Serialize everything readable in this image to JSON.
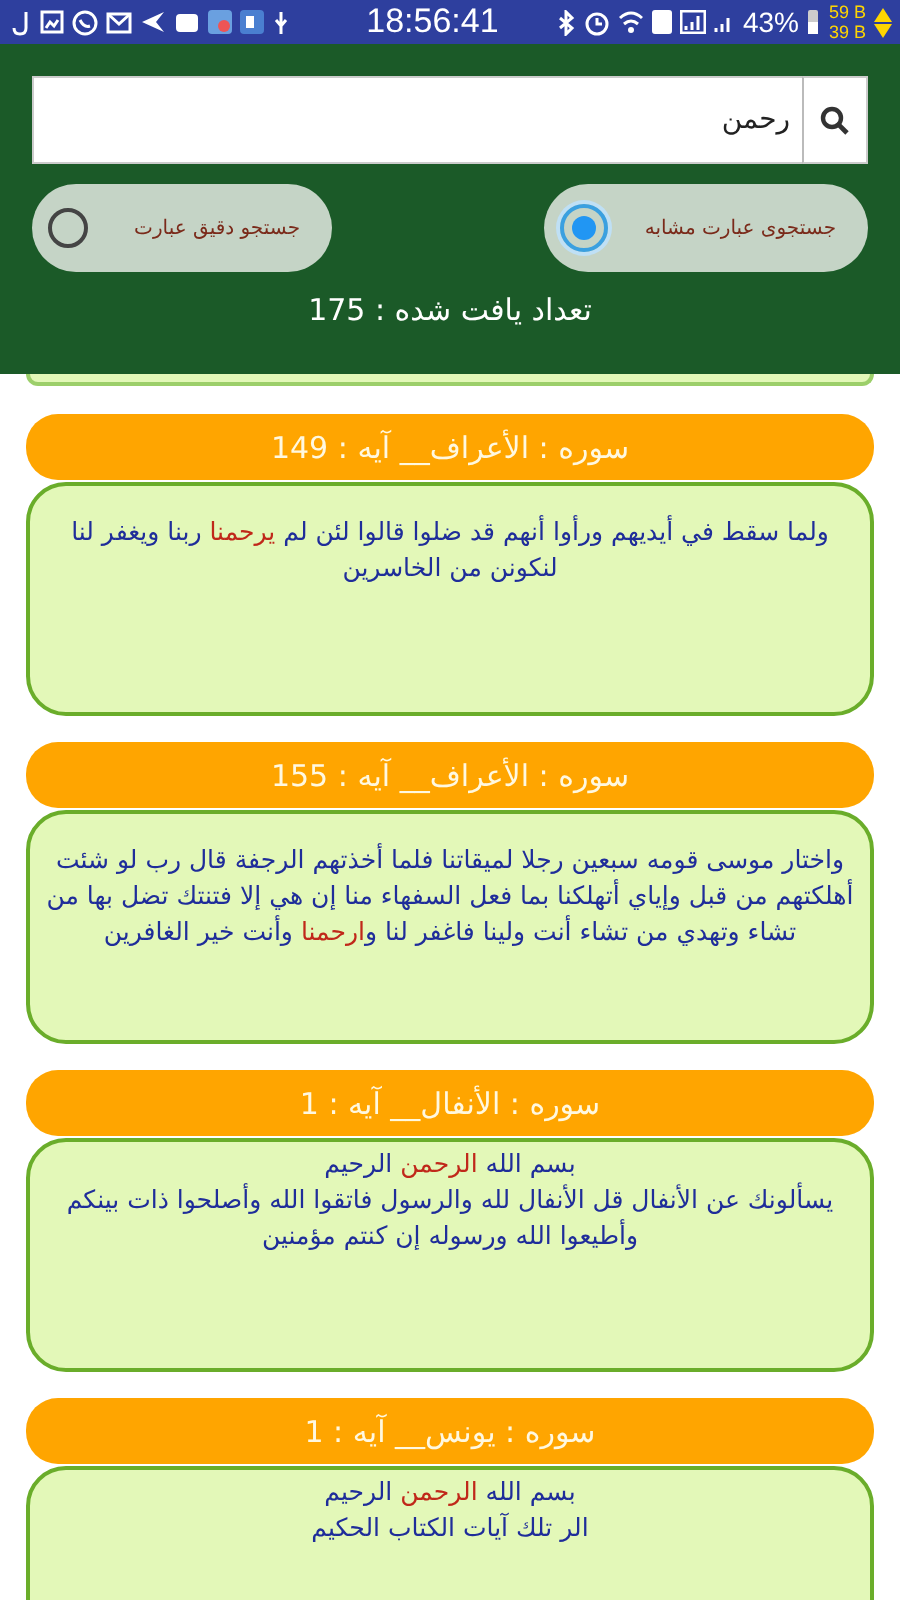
{
  "status_bar": {
    "time": "18:56:41",
    "battery": "43%",
    "upload_speed": "59 B",
    "download_speed": "39 B"
  },
  "search": {
    "value": "رحمن"
  },
  "search_modes": [
    {
      "label": "جستجوی عبارت مشابه",
      "selected": true
    },
    {
      "label": "جستجو دقیق عبارت",
      "selected": false
    }
  ],
  "result_count": "تعداد یافت شده : 175",
  "results": [
    {
      "title": "سوره : الأعراف__ آیه : 149",
      "verse": [
        {
          "text": "ولما سقط في أيديهم ورأوا أنهم قد ضلوا قالوا لئن لم ",
          "highlight": false
        },
        {
          "text": "يرحمنا",
          "highlight": true
        },
        {
          "text": " ربنا ويغفر لنا لنكونن من الخاسرين",
          "highlight": false
        }
      ]
    },
    {
      "title": "سوره : الأعراف__ آیه : 155",
      "verse": [
        {
          "text": "واختار موسى قومه سبعين رجلا لميقاتنا فلما أخذتهم الرجفة قال رب لو شئت أهلكتهم من قبل وإياي أتهلكنا بما فعل السفهاء منا إن هي إلا فتنتك تضل بها من تشاء وتهدي من تشاء أنت ولينا فاغفر لنا و",
          "highlight": false
        },
        {
          "text": "ارحمنا",
          "highlight": true
        },
        {
          "text": " وأنت خير الغافرين",
          "highlight": false
        }
      ]
    },
    {
      "title": "سوره : الأنفال__ آیه : 1",
      "basmala": [
        {
          "text": "بسم الله ",
          "highlight": false
        },
        {
          "text": "الرحمن",
          "highlight": true
        },
        {
          "text": " الرحيم",
          "highlight": false
        }
      ],
      "verse": [
        {
          "text": "يسألونك عن الأنفال قل الأنفال لله والرسول فاتقوا الله وأصلحوا ذات بينكم وأطيعوا الله ورسوله إن كنتم مؤمنين",
          "highlight": false
        }
      ]
    },
    {
      "title": "سوره : یونس__ آیه : 1",
      "basmala": [
        {
          "text": "بسم الله ",
          "highlight": false
        },
        {
          "text": "الرحمن",
          "highlight": true
        },
        {
          "text": " الرحيم",
          "highlight": false
        }
      ],
      "verse": [
        {
          "text": "الر تلك آيات الكتاب الحكيم",
          "highlight": false
        }
      ]
    }
  ]
}
